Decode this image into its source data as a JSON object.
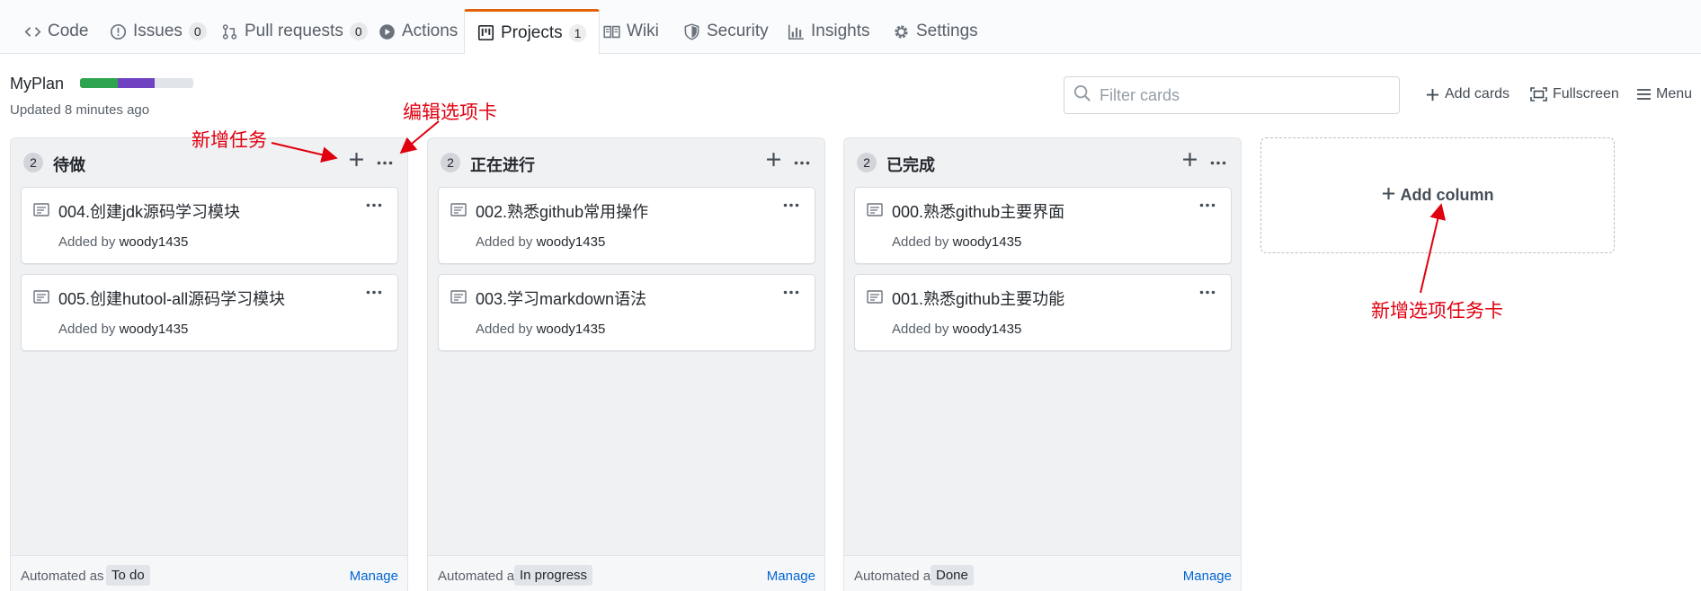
{
  "nav": {
    "tabs": [
      {
        "label": "Code",
        "icon": "code-icon"
      },
      {
        "label": "Issues",
        "count": "0",
        "icon": "issue-icon"
      },
      {
        "label": "Pull requests",
        "count": "0",
        "icon": "pull-request-icon"
      },
      {
        "label": "Actions",
        "icon": "play-icon"
      },
      {
        "label": "Projects",
        "count": "1",
        "icon": "project-icon",
        "selected": true
      },
      {
        "label": "Wiki",
        "icon": "book-icon"
      },
      {
        "label": "Security",
        "icon": "shield-icon"
      },
      {
        "label": "Insights",
        "icon": "graph-icon"
      },
      {
        "label": "Settings",
        "icon": "gear-icon"
      }
    ]
  },
  "project": {
    "name": "MyPlan",
    "updated": "Updated 8 minutes ago",
    "progress": {
      "done": 0.33,
      "in_progress": 0.33,
      "todo": 0.34,
      "colors": {
        "done": "#2ea44f",
        "in_progress": "#6f42c1",
        "todo": "#e1e4e8"
      }
    }
  },
  "toolbar": {
    "filter_placeholder": "Filter cards",
    "add_cards": "Add cards",
    "fullscreen": "Fullscreen",
    "menu": "Menu"
  },
  "columns": [
    {
      "name": "待做",
      "count": "2",
      "automation_label": "Automated as",
      "automation_value": "To do",
      "manage": "Manage",
      "cards": [
        {
          "title": "004.创建jdk源码学习模块",
          "added_by_label": "Added by",
          "user": "woody1435"
        },
        {
          "title": "005.创建hutool-all源码学习模块",
          "added_by_label": "Added by",
          "user": "woody1435"
        }
      ]
    },
    {
      "name": "正在进行",
      "count": "2",
      "automation_label": "Automated as",
      "automation_value": "In progress",
      "manage": "Manage",
      "cards": [
        {
          "title": "002.熟悉github常用操作",
          "added_by_label": "Added by",
          "user": "woody1435"
        },
        {
          "title": "003.学习markdown语法",
          "added_by_label": "Added by",
          "user": "woody1435"
        }
      ]
    },
    {
      "name": "已完成",
      "count": "2",
      "automation_label": "Automated as",
      "automation_value": "Done",
      "manage": "Manage",
      "cards": [
        {
          "title": "000.熟悉github主要界面",
          "added_by_label": "Added by",
          "user": "woody1435"
        },
        {
          "title": "001.熟悉github主要功能",
          "added_by_label": "Added by",
          "user": "woody1435"
        }
      ]
    }
  ],
  "add_column": "Add column",
  "annotations": {
    "add_task": "新增任务",
    "edit_tab": "编辑选项卡",
    "add_column_note": "新增选项任务卡",
    "color": "#e0000f"
  },
  "colors": {
    "accent_tab": "#e36209",
    "link": "#0366d6"
  }
}
